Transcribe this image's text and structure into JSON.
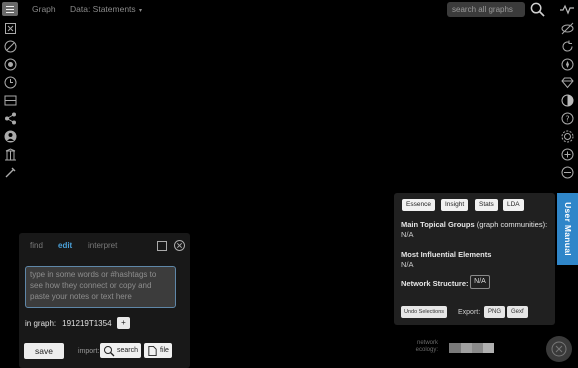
{
  "topbar": {
    "graph_label": "Graph",
    "data_label": "Data: Statements",
    "search_placeholder": "search all graphs"
  },
  "left_icons": [
    "document-icon",
    "fullscreen-icon",
    "bubble-icon",
    "clock-icon",
    "layout-icon",
    "share-icon",
    "user-icon",
    "pillar-icon",
    "tools-icon"
  ],
  "right_icons": [
    "eye-off-icon",
    "refresh-icon",
    "compass-icon",
    "diamond-icon",
    "contrast-icon",
    "help-icon",
    "gear-icon",
    "add-circle-icon",
    "settings-circle-icon"
  ],
  "editor": {
    "tabs": [
      "find",
      "edit",
      "interpret"
    ],
    "active_tab": "edit",
    "textarea_placeholder": "type in some words or #hashtags to see how they connect or copy and paste your notes or text here",
    "in_graph_label": "in graph:",
    "graph_id": "191219T1354",
    "plus_label": "+",
    "save_label": "save",
    "import_label": "import:",
    "import_search_label": "search",
    "import_file_label": "file"
  },
  "insights": {
    "tabs": [
      "Essence",
      "Insight",
      "Stats",
      "LDA"
    ],
    "main_groups_title": "Main Topical Groups",
    "main_groups_sub": "(graph communities):",
    "main_groups_value": "N/A",
    "influential_title": "Most Influential Elements",
    "influential_value": "N/A",
    "structure_title": "Network Structure:",
    "structure_value": "N/A",
    "undo_label": "Undo Selections",
    "export_label": "Export:",
    "export_png": "PNG",
    "export_gexf": "Gexf"
  },
  "user_manual_label": "User Manual",
  "network_ecology_label": "network ecology:",
  "colors": {
    "accent_blue": "#2f86c9",
    "active_tab": "#4aa0d8",
    "background": "#000000"
  }
}
